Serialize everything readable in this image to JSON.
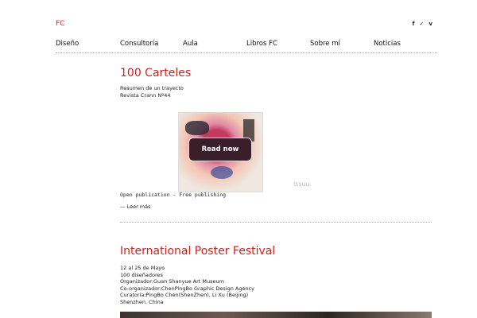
{
  "site": {
    "logo": "FC"
  },
  "social": [
    {
      "icon": "facebook-icon",
      "glyph": "f"
    },
    {
      "icon": "twitter-icon",
      "glyph": "✓"
    },
    {
      "icon": "vimeo-icon",
      "glyph": "v"
    }
  ],
  "nav": [
    "Diseño",
    "Consultoría",
    "Aula",
    "Libros FC",
    "Sobre mí",
    "Noticias"
  ],
  "post1": {
    "title": "100 Carteles",
    "lines": [
      "Resumen de un trayecto",
      "Revista Crann Nº44"
    ],
    "embed": {
      "button": "Read now",
      "brand": "issuu"
    },
    "caption": "Open publication - Free publishing",
    "more": "— Leer más"
  },
  "post2": {
    "title": "International Poster Festival",
    "lines": [
      "12 al 25 de Mayo",
      "100 diseñadores",
      "Organizador:Guan Shanyue Art Museum",
      "Co-organizador:ChenPingBo Graphic Design Agency",
      "Curatoría:PingBo Chen(ShenZhen), Li Xu (Beijing)",
      "Shenzhen. China"
    ]
  }
}
